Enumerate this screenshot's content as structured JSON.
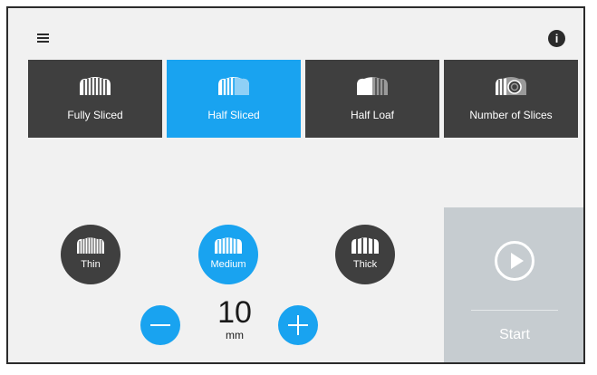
{
  "modes": [
    {
      "label": "Fully Sliced",
      "icon": "fully-sliced-loaf-icon",
      "active": false
    },
    {
      "label": "Half Sliced",
      "icon": "half-sliced-loaf-icon",
      "active": true
    },
    {
      "label": "Half Loaf",
      "icon": "half-loaf-icon",
      "active": false
    },
    {
      "label": "Number of Slices",
      "icon": "number-of-slices-icon",
      "active": false
    }
  ],
  "thickness": [
    {
      "label": "Thin",
      "active": false
    },
    {
      "label": "Medium",
      "active": true
    },
    {
      "label": "Thick",
      "active": false
    }
  ],
  "slice_thickness": {
    "value": "10",
    "unit": "mm"
  },
  "start": {
    "label": "Start",
    "icon": "play-icon"
  },
  "colors": {
    "accent": "#19a3f0",
    "dark_button": "#3f3f3f",
    "disabled_panel": "#c6ccd0"
  }
}
